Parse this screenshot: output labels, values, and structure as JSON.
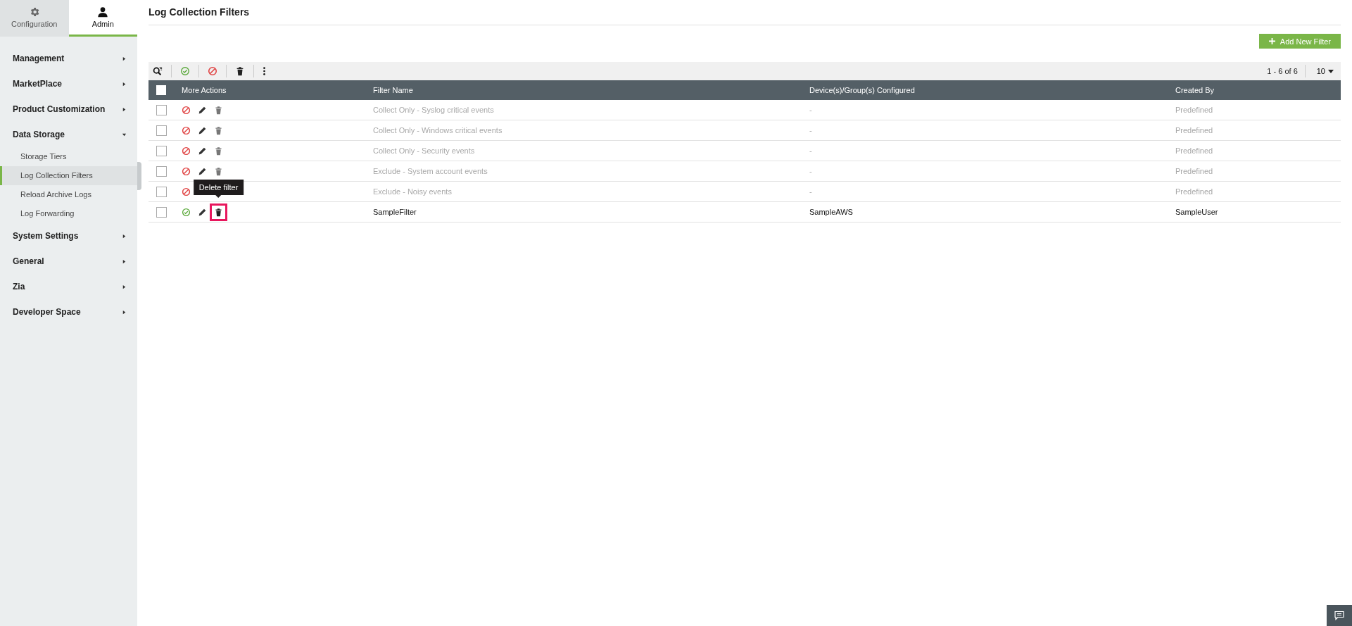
{
  "top_tabs": [
    {
      "label": "Configuration",
      "selected": false
    },
    {
      "label": "Admin",
      "selected": true
    }
  ],
  "sidebar": {
    "items": [
      {
        "label": "Management",
        "expanded": false
      },
      {
        "label": "MarketPlace",
        "expanded": false
      },
      {
        "label": "Product Customization",
        "expanded": false
      },
      {
        "label": "Data Storage",
        "expanded": true,
        "children": [
          {
            "label": "Storage Tiers",
            "selected": false
          },
          {
            "label": "Log Collection Filters",
            "selected": true
          },
          {
            "label": "Reload Archive Logs",
            "selected": false
          },
          {
            "label": "Log Forwarding",
            "selected": false
          }
        ]
      },
      {
        "label": "System Settings",
        "expanded": false
      },
      {
        "label": "General",
        "expanded": false
      },
      {
        "label": "Zia",
        "expanded": false
      },
      {
        "label": "Developer Space",
        "expanded": false
      }
    ]
  },
  "page_title": "Log Collection Filters",
  "add_button": "Add New Filter",
  "pagination": {
    "range": "1 - 6 of 6",
    "page_size": "10"
  },
  "table": {
    "select_all_checked": false,
    "columns": [
      "More Actions",
      "Filter Name",
      "Device(s)/Group(s) Configured",
      "Created By"
    ],
    "rows": [
      {
        "checked": false,
        "enabled": false,
        "predefined": true,
        "filter_name": "Collect Only - Syslog critical events",
        "devices": "-",
        "created_by": "Predefined",
        "delete_highlighted": false
      },
      {
        "checked": false,
        "enabled": false,
        "predefined": true,
        "filter_name": "Collect Only - Windows critical events",
        "devices": "-",
        "created_by": "Predefined",
        "delete_highlighted": false
      },
      {
        "checked": false,
        "enabled": false,
        "predefined": true,
        "filter_name": "Collect Only - Security events",
        "devices": "-",
        "created_by": "Predefined",
        "delete_highlighted": false
      },
      {
        "checked": false,
        "enabled": false,
        "predefined": true,
        "filter_name": "Exclude - System account events",
        "devices": "-",
        "created_by": "Predefined",
        "delete_highlighted": false
      },
      {
        "checked": false,
        "enabled": false,
        "predefined": true,
        "filter_name": "Exclude - Noisy events",
        "devices": "-",
        "created_by": "Predefined"
      },
      {
        "checked": false,
        "enabled": true,
        "predefined": false,
        "filter_name": "SampleFilter",
        "devices": "SampleAWS",
        "created_by": "SampleUser",
        "delete_highlighted": true,
        "delete_tooltip": "Delete filter"
      }
    ]
  }
}
